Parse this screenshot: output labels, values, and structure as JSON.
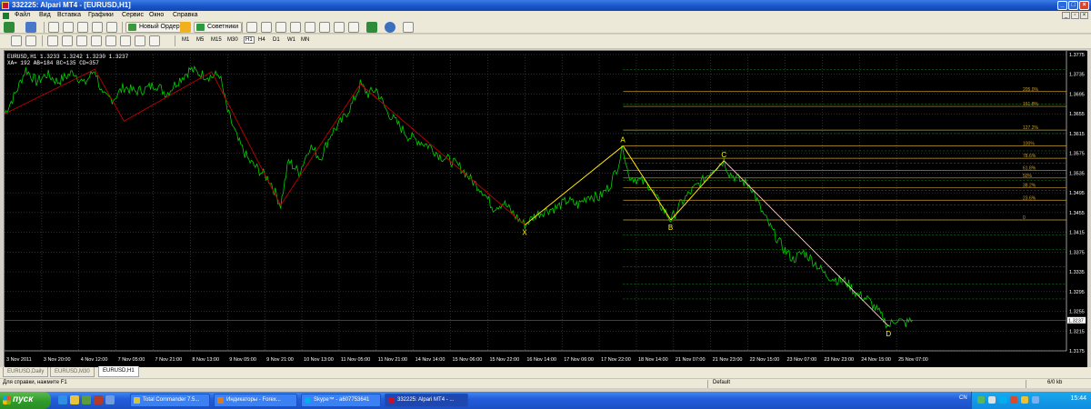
{
  "window": {
    "title": "332225: Alpari MT4 - [EURUSD,H1]"
  },
  "menu": [
    "Файл",
    "Вид",
    "Вставка",
    "Графики",
    "Сервис",
    "Окно",
    "Справка"
  ],
  "toolbar": {
    "new_order": "Новый Ордер",
    "experts": "Советники",
    "timeframes": [
      "M1",
      "M5",
      "M15",
      "M30",
      "H1",
      "H4",
      "D1",
      "W1",
      "MN"
    ],
    "active_timeframe": "H1"
  },
  "chart": {
    "info_line1": "EURUSD,H1  1.3233 1.3242 1.3230 1.3237",
    "info_line2": "XA= 192 AB=184 BC=135 CD=357"
  },
  "chart_data": {
    "type": "line",
    "symbol": "EURUSD",
    "timeframe": "H1",
    "ylim": [
      1.3175,
      1.3775
    ],
    "xlim": [
      0,
      400
    ],
    "y_ticks": [
      "1.3775",
      "1.3735",
      "1.3695",
      "1.3655",
      "1.3615",
      "1.3575",
      "1.3535",
      "1.3495",
      "1.3455",
      "1.3415",
      "1.3375",
      "1.3335",
      "1.3295",
      "1.3255",
      "1.3215",
      "1.3175"
    ],
    "current_price": "1.3237",
    "x_ticks": [
      {
        "x": 0,
        "label": "3 Nov 2011"
      },
      {
        "x": 14,
        "label": "3 Nov 20:00"
      },
      {
        "x": 28,
        "label": "4 Nov 12:00"
      },
      {
        "x": 42,
        "label": "7 Nov 05:00"
      },
      {
        "x": 56,
        "label": "7 Nov 21:00"
      },
      {
        "x": 70,
        "label": "8 Nov 13:00"
      },
      {
        "x": 84,
        "label": "9 Nov 05:00"
      },
      {
        "x": 98,
        "label": "9 Nov 21:00"
      },
      {
        "x": 112,
        "label": "10 Nov 13:00"
      },
      {
        "x": 126,
        "label": "11 Nov 05:00"
      },
      {
        "x": 140,
        "label": "11 Nov 21:00"
      },
      {
        "x": 154,
        "label": "14 Nov 14:00"
      },
      {
        "x": 168,
        "label": "15 Nov 06:00"
      },
      {
        "x": 182,
        "label": "15 Nov 22:00"
      },
      {
        "x": 196,
        "label": "16 Nov 14:00"
      },
      {
        "x": 210,
        "label": "17 Nov 06:00"
      },
      {
        "x": 224,
        "label": "17 Nov 22:00"
      },
      {
        "x": 238,
        "label": "18 Nov 14:00"
      },
      {
        "x": 252,
        "label": "21 Nov 07:00"
      },
      {
        "x": 266,
        "label": "21 Nov 23:00"
      },
      {
        "x": 280,
        "label": "22 Nov 15:00"
      },
      {
        "x": 294,
        "label": "23 Nov 07:00"
      },
      {
        "x": 308,
        "label": "23 Nov 23:00"
      },
      {
        "x": 322,
        "label": "24 Nov 15:00"
      },
      {
        "x": 336,
        "label": "25 Nov 07:00"
      }
    ],
    "price_anchors": [
      [
        0,
        1.3655
      ],
      [
        4,
        1.3695
      ],
      [
        8,
        1.3745
      ],
      [
        12,
        1.372
      ],
      [
        16,
        1.3735
      ],
      [
        20,
        1.372
      ],
      [
        26,
        1.374
      ],
      [
        30,
        1.3715
      ],
      [
        34,
        1.3745
      ],
      [
        37,
        1.369
      ],
      [
        41,
        1.3685
      ],
      [
        45,
        1.371
      ],
      [
        49,
        1.37
      ],
      [
        53,
        1.3705
      ],
      [
        57,
        1.3715
      ],
      [
        61,
        1.3695
      ],
      [
        65,
        1.372
      ],
      [
        70,
        1.3745
      ],
      [
        74,
        1.3735
      ],
      [
        78,
        1.373
      ],
      [
        81,
        1.3735
      ],
      [
        84,
        1.366
      ],
      [
        88,
        1.36
      ],
      [
        92,
        1.356
      ],
      [
        96,
        1.354
      ],
      [
        100,
        1.352
      ],
      [
        104,
        1.347
      ],
      [
        107,
        1.356
      ],
      [
        111,
        1.3535
      ],
      [
        115,
        1.359
      ],
      [
        119,
        1.3565
      ],
      [
        123,
        1.3615
      ],
      [
        127,
        1.364
      ],
      [
        131,
        1.3675
      ],
      [
        134,
        1.3715
      ],
      [
        137,
        1.3695
      ],
      [
        140,
        1.3705
      ],
      [
        144,
        1.366
      ],
      [
        148,
        1.3635
      ],
      [
        152,
        1.361
      ],
      [
        156,
        1.36
      ],
      [
        160,
        1.359
      ],
      [
        164,
        1.357
      ],
      [
        168,
        1.356
      ],
      [
        172,
        1.3545
      ],
      [
        176,
        1.352
      ],
      [
        180,
        1.35
      ],
      [
        184,
        1.3465
      ],
      [
        188,
        1.3475
      ],
      [
        192,
        1.345
      ],
      [
        196,
        1.343
      ],
      [
        200,
        1.345
      ],
      [
        204,
        1.346
      ],
      [
        208,
        1.3465
      ],
      [
        212,
        1.348
      ],
      [
        216,
        1.347
      ],
      [
        220,
        1.349
      ],
      [
        224,
        1.3485
      ],
      [
        228,
        1.351
      ],
      [
        231,
        1.355
      ],
      [
        233,
        1.359
      ],
      [
        235,
        1.353
      ],
      [
        239,
        1.352
      ],
      [
        243,
        1.351
      ],
      [
        247,
        1.347
      ],
      [
        251,
        1.344
      ],
      [
        255,
        1.3475
      ],
      [
        259,
        1.35
      ],
      [
        263,
        1.352
      ],
      [
        267,
        1.3545
      ],
      [
        271,
        1.356
      ],
      [
        273,
        1.3535
      ],
      [
        277,
        1.352
      ],
      [
        281,
        1.351
      ],
      [
        285,
        1.346
      ],
      [
        289,
        1.342
      ],
      [
        293,
        1.3385
      ],
      [
        297,
        1.336
      ],
      [
        301,
        1.3375
      ],
      [
        305,
        1.3355
      ],
      [
        309,
        1.333
      ],
      [
        313,
        1.332
      ],
      [
        317,
        1.3315
      ],
      [
        321,
        1.329
      ],
      [
        325,
        1.328
      ],
      [
        329,
        1.3255
      ],
      [
        333,
        1.3225
      ],
      [
        336,
        1.324
      ],
      [
        339,
        1.323
      ],
      [
        342,
        1.3237
      ]
    ],
    "zigzag": [
      [
        0,
        1.3655
      ],
      [
        34,
        1.3745
      ],
      [
        45,
        1.364
      ],
      [
        78,
        1.374
      ],
      [
        104,
        1.347
      ],
      [
        134,
        1.3715
      ],
      [
        196,
        1.343
      ],
      [
        233,
        1.359
      ],
      [
        251,
        1.344
      ],
      [
        271,
        1.356
      ],
      [
        333,
        1.3225
      ]
    ],
    "pattern_points": [
      {
        "label": "X",
        "x": 196,
        "y": 1.343
      },
      {
        "label": "A",
        "x": 233,
        "y": 1.359
      },
      {
        "label": "B",
        "x": 251,
        "y": 1.344
      },
      {
        "label": "C",
        "x": 271,
        "y": 1.356
      },
      {
        "label": "D",
        "x": 333,
        "y": 1.3225
      }
    ],
    "fib_levels": [
      {
        "label": "205.0%",
        "y": 1.37
      },
      {
        "label": "161.8%",
        "y": 1.367
      },
      {
        "label": "127.2%",
        "y": 1.3622
      },
      {
        "label": "100%",
        "y": 1.359
      },
      {
        "label": "78.6%",
        "y": 1.3565
      },
      {
        "label": "61.8%",
        "y": 1.354
      },
      {
        "label": "50%",
        "y": 1.3525
      },
      {
        "label": "38.2%",
        "y": 1.3505
      },
      {
        "label": "23.6%",
        "y": 1.348
      },
      {
        "label": "0",
        "y": 1.344
      }
    ],
    "fib_extension_levels": [
      1.3745,
      1.3675,
      1.3615,
      1.358,
      1.3555,
      1.352,
      1.35,
      1.347,
      1.344,
      1.341,
      1.338,
      1.3345,
      1.331,
      1.328
    ],
    "colors": {
      "background": "#000000",
      "grid": "#5a5a5a",
      "price": "#00d000",
      "zigzag": "#c00000",
      "pattern": "#ffff00",
      "fib_retracement": "#c8a02a",
      "fib_extension": "#1e9e1e",
      "cd_leg": "#ffffff",
      "axis_text": "#ffffff"
    }
  },
  "tabs": [
    "EURUSD,Daily",
    "EURUSD,M30",
    "EURUSD,H1"
  ],
  "status": {
    "help": "Для справки, нажмите F1",
    "profile": "Default",
    "traffic": "6/0 kb"
  },
  "taskbar": {
    "start": "пуск",
    "tasks": [
      "Total Commander 7.5...",
      "Индикаторы - Forex...",
      "Skype™ - a607753641",
      "332225: Alpari MT4 - ..."
    ],
    "lang": "CN",
    "clock": "15:44"
  }
}
